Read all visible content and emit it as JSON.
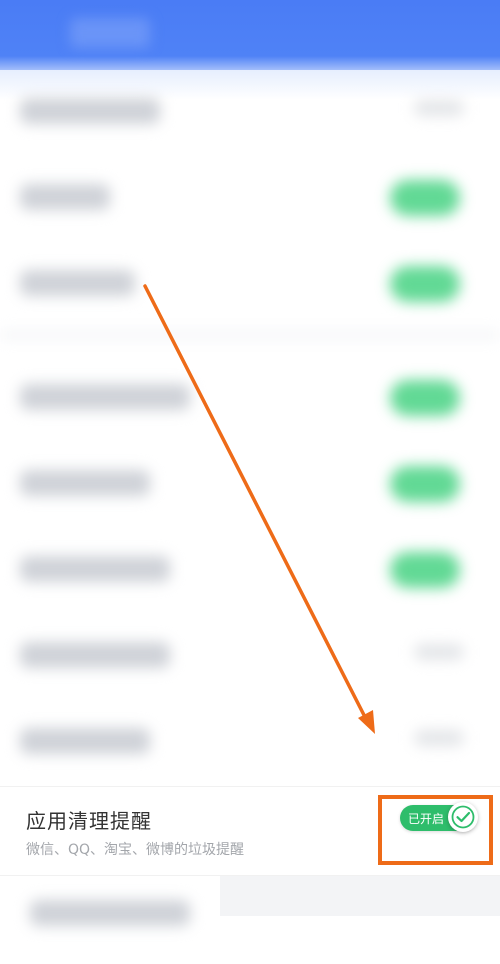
{
  "setting": {
    "title": "应用清理提醒",
    "subtitle": "微信、QQ、淘宝、微博的垃圾提醒",
    "toggle_label": "已开启",
    "toggle_state": "on"
  },
  "colors": {
    "header": "#4a7cf5",
    "toggle_on": "#2ebd6b",
    "annotation": "#ee6b18"
  },
  "icons": {
    "toggle_knob": "check-icon"
  }
}
